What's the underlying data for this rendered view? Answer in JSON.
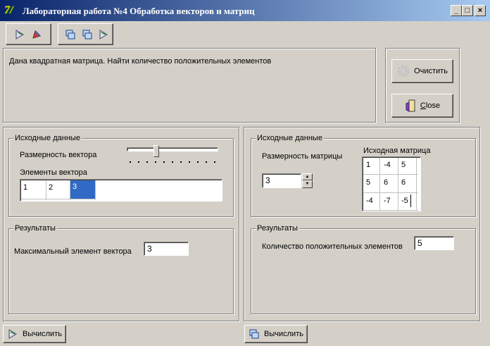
{
  "window": {
    "title": "Лабораторная работа №4 Обработка векторов и матриц",
    "icon_glyph": "7/",
    "min_label": "_",
    "max_label": "□",
    "close_label": "×"
  },
  "task_text": "Дана квадратная матрица. Найти количество положительных элементов",
  "buttons": {
    "clear_label": "Очистить",
    "close_label": "Close"
  },
  "vector_panel": {
    "input_title": "Исходные данные",
    "size_label": "Размерность вектора",
    "elements_label": "Элементы вектора",
    "elements": [
      "1",
      "2",
      "3"
    ],
    "results_title": "Результаты",
    "max_label": "Максимальный элемент вектора",
    "max_value": "3",
    "calc_label": "Вычислить"
  },
  "matrix_panel": {
    "input_title": "Исходные данные",
    "size_label": "Размерность матрицы",
    "size_value": "3",
    "matrix_label": "Исходная матрица",
    "matrix": [
      [
        "1",
        "-4",
        "5"
      ],
      [
        "5",
        "6",
        "6"
      ],
      [
        "-4",
        "-7",
        "-5"
      ]
    ],
    "results_title": "Результаты",
    "count_label": "Количество положительных элементов",
    "count_value": "5",
    "calc_label": "Вычислить"
  }
}
